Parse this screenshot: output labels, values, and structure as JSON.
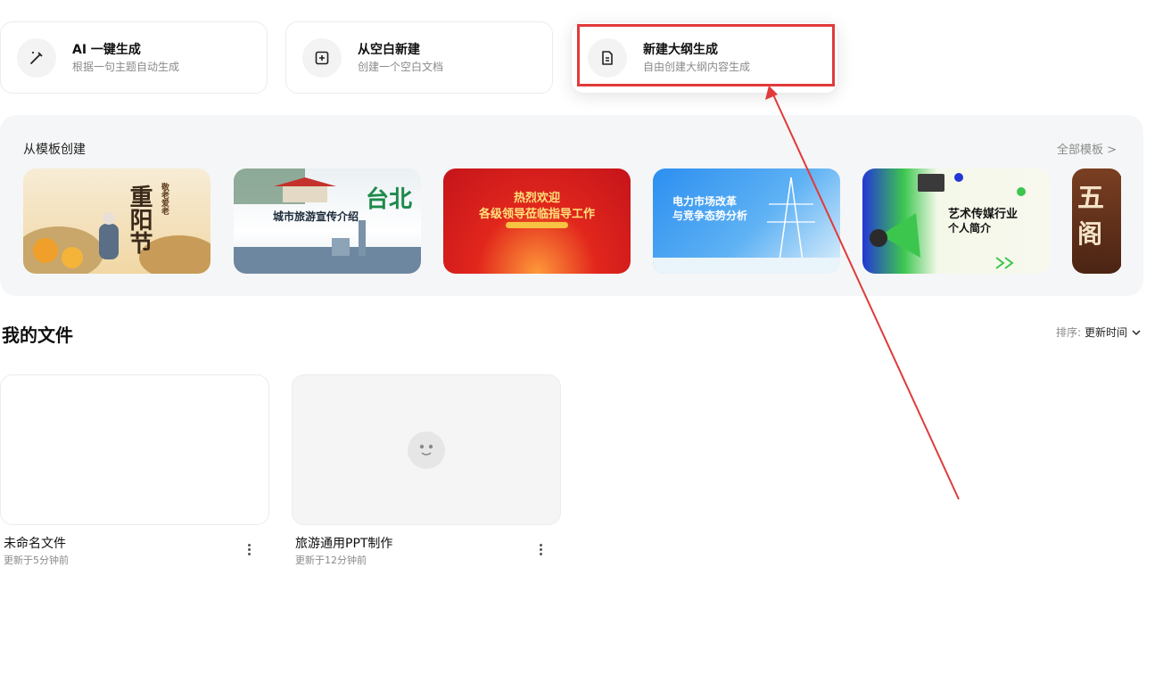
{
  "create_options": [
    {
      "title": "AI 一键生成",
      "desc": "根据一句主题自动生成",
      "icon": "magic-wand-icon"
    },
    {
      "title": "从空白新建",
      "desc": "创建一个空白文档",
      "icon": "add-square-icon"
    },
    {
      "title": "新建大纲生成",
      "desc": "自由创建大纲内容生成",
      "icon": "document-icon"
    }
  ],
  "templates": {
    "title": "从模板创建",
    "view_all": "全部模板 >",
    "items": [
      {
        "caption": "重阳节",
        "subcaption": "敬老爱老"
      },
      {
        "caption": "城市旅游宣传介绍",
        "subcaption": "台北"
      },
      {
        "caption": "热烈欢迎",
        "subcaption": "各级领导莅临指导工作"
      },
      {
        "caption": "电力市场改革",
        "subcaption": "与竞争态势分析"
      },
      {
        "caption": "艺术传媒行业",
        "subcaption": "个人简介"
      },
      {
        "caption": "五",
        "subcaption": "阁"
      }
    ]
  },
  "files": {
    "title": "我的文件",
    "sort_label": "排序:",
    "sort_value": "更新时间",
    "items": [
      {
        "name": "未命名文件",
        "updated": "更新于5分钟前"
      },
      {
        "name": "旅游通用PPT制作",
        "updated": "更新于12分钟前"
      }
    ]
  },
  "colors": {
    "highlight": "#e13a3a",
    "panel_bg": "#f5f6f7"
  }
}
